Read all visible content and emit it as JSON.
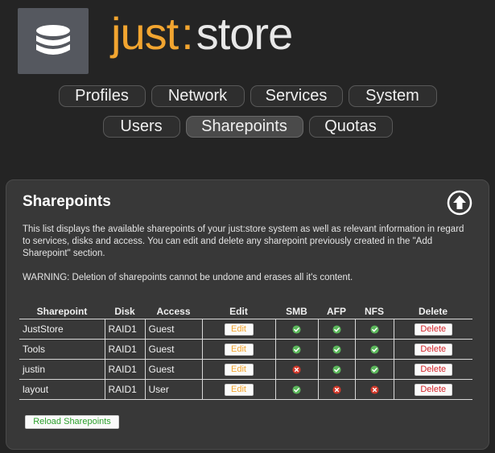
{
  "brand": {
    "part1": "just",
    "separator": ":",
    "part2": "store",
    "icon": "database-icon",
    "accent_color": "#f2a530"
  },
  "nav": {
    "row1": [
      {
        "label": "Profiles",
        "name": "nav-profiles"
      },
      {
        "label": "Network",
        "name": "nav-network"
      },
      {
        "label": "Services",
        "name": "nav-services"
      },
      {
        "label": "System",
        "name": "nav-system"
      }
    ],
    "row2": [
      {
        "label": "Users",
        "name": "nav-users"
      },
      {
        "label": "Sharepoints",
        "name": "nav-sharepoints",
        "active": true
      },
      {
        "label": "Quotas",
        "name": "nav-quotas"
      }
    ]
  },
  "panel": {
    "title": "Sharepoints",
    "up_icon": "circle-arrow-up-icon",
    "description": "This list displays the available sharepoints of your just:store system as well as relevant information in regard to services, disks and access. You can edit and delete any sharepoint previously created in the \"Add Sharepoint\" section.",
    "warning": "WARNING: Deletion of sharepoints cannot be undone and erases all it's content."
  },
  "table": {
    "headers": [
      "Sharepoint",
      "Disk",
      "Access",
      "Edit",
      "SMB",
      "AFP",
      "NFS",
      "Delete"
    ],
    "edit_label": "Edit",
    "delete_label": "Delete",
    "rows": [
      {
        "name": "JustStore",
        "disk": "RAID1",
        "access": "Guest",
        "smb": true,
        "afp": true,
        "nfs": true
      },
      {
        "name": "Tools",
        "disk": "RAID1",
        "access": "Guest",
        "smb": true,
        "afp": true,
        "nfs": true
      },
      {
        "name": "justin",
        "disk": "RAID1",
        "access": "Guest",
        "smb": false,
        "afp": true,
        "nfs": true
      },
      {
        "name": "layout",
        "disk": "RAID1",
        "access": "User",
        "smb": true,
        "afp": false,
        "nfs": false
      }
    ],
    "status_colors": {
      "enabled": "#5cb85c",
      "disabled": "#d33a2c"
    }
  },
  "reload_label": "Reload Sharepoints"
}
